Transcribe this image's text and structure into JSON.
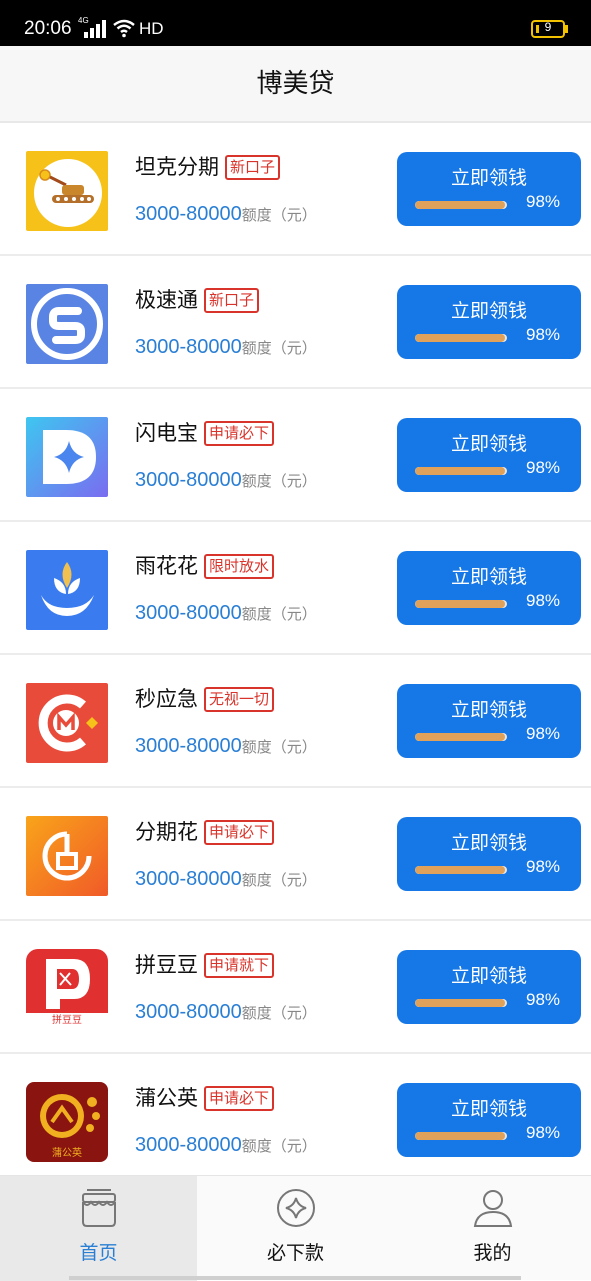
{
  "status_bar": {
    "time": "20:06",
    "network": "4G",
    "hd": "HD",
    "battery": "9"
  },
  "header": {
    "title": "博美贷"
  },
  "common": {
    "amount_unit": "额度（元）"
  },
  "items": [
    {
      "name": "坦克分期",
      "tag": "新口子",
      "amount": "3000-80000",
      "button": "立即领钱",
      "percent": "98%",
      "progress": 0.98,
      "icon": "tank-icon"
    },
    {
      "name": "极速通",
      "tag": "新口子",
      "amount": "3000-80000",
      "button": "立即领钱",
      "percent": "98%",
      "progress": 0.98,
      "icon": "s-shield-icon"
    },
    {
      "name": "闪电宝",
      "tag": "申请必下",
      "amount": "3000-80000",
      "button": "立即领钱",
      "percent": "98%",
      "progress": 0.98,
      "icon": "d-star-icon"
    },
    {
      "name": "雨花花",
      "tag": "限时放水",
      "amount": "3000-80000",
      "button": "立即领钱",
      "percent": "98%",
      "progress": 0.98,
      "icon": "lotus-hand-icon"
    },
    {
      "name": "秒应急",
      "tag": "无视一切",
      "amount": "3000-80000",
      "button": "立即领钱",
      "percent": "98%",
      "progress": 0.98,
      "icon": "cm-icon"
    },
    {
      "name": "分期花",
      "tag": "申请必下",
      "amount": "3000-80000",
      "button": "立即领钱",
      "percent": "98%",
      "progress": 0.98,
      "icon": "g-circle-icon"
    },
    {
      "name": "拼豆豆",
      "tag": "申请就下",
      "amount": "3000-80000",
      "button": "立即领钱",
      "percent": "98%",
      "progress": 0.98,
      "icon": "pdd-icon",
      "icon_text": "拼豆豆"
    },
    {
      "name": "蒲公英",
      "tag": "申请必下",
      "amount": "3000-80000",
      "button": "立即领钱",
      "percent": "98%",
      "progress": 0.98,
      "icon": "dandelion-coin-icon",
      "icon_text": "蒲公英"
    }
  ],
  "tabs": [
    {
      "label": "首页",
      "icon": "shop-icon",
      "active": true
    },
    {
      "label": "必下款",
      "icon": "diamond-badge-icon",
      "active": false
    },
    {
      "label": "我的",
      "icon": "user-icon",
      "active": false
    }
  ],
  "colors": {
    "accent": "#1677e6",
    "tag_red": "#d9342b",
    "amount_blue": "#2a7fd4",
    "progress_fill": "#e0a25a"
  }
}
